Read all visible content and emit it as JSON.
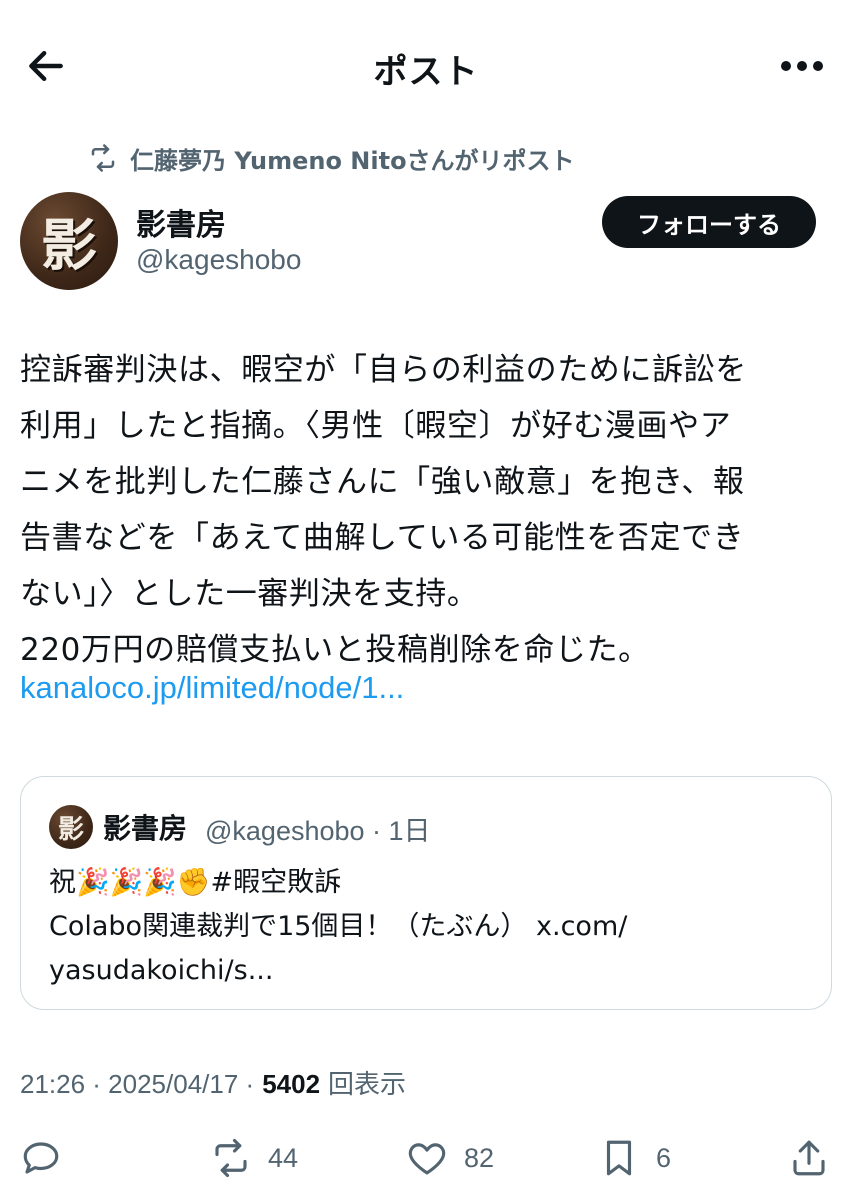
{
  "header": {
    "title": "ポスト"
  },
  "repost": {
    "text": "仁藤夢乃  Yumeno Nitoさんがリポスト"
  },
  "author": {
    "avatar_glyph": "影",
    "name": "影書房",
    "handle": "@kageshobo",
    "follow_label": "フォローする"
  },
  "post": {
    "body": "控訴審判決は、暇空が「自らの利益のために訴訟を\n利用」したと指摘。〈男性〔暇空〕が好む漫画やア\nニメを批判した仁藤さんに「強い敵意」を抱き、報\n告書などを「あえて曲解している可能性を否定でき\nない」〉とした一審判決を支持。\n220万円の賠償支払いと投稿削除を命じた。",
    "link": "kanaloco.jp/limited/node/1..."
  },
  "quote": {
    "avatar_glyph": "影",
    "name": "影書房",
    "handle_time": "@kageshobo · 1日",
    "text": "祝🎉🎉🎉✊#暇空敗訴\nColabo関連裁判で15個目！（たぶん） x.com/\nyasudakoichi/s..."
  },
  "meta": {
    "time": "21:26 · 2025/04/17 ·",
    "views_count": "5402",
    "views_label": "回表示"
  },
  "actions": {
    "reply_count": "",
    "retweet_count": "44",
    "like_count": "82",
    "bookmark_count": "6"
  },
  "colors": {
    "text": "#0f1419",
    "secondary": "#536471",
    "link": "#1d9bf0",
    "border": "#cfd9de"
  }
}
